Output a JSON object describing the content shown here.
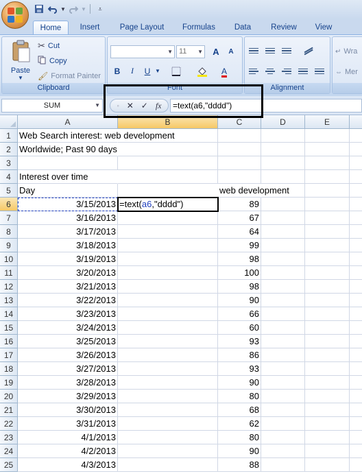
{
  "quick_access": {
    "save_icon": "save-icon",
    "undo_icon": "undo-icon",
    "redo_icon": "redo-icon",
    "customize_icon": "customize-icon"
  },
  "tabs": [
    "Home",
    "Insert",
    "Page Layout",
    "Formulas",
    "Data",
    "Review",
    "View"
  ],
  "ribbon": {
    "clipboard": {
      "paste": "Paste",
      "cut": "Cut",
      "copy": "Copy",
      "format_painter": "Format Painter",
      "label": "Clipboard"
    },
    "font": {
      "font_name": "",
      "font_size": "11",
      "label": "Font",
      "bold": "B",
      "italic": "I",
      "underline": "U",
      "grow": "A",
      "shrink": "A",
      "font_color": "A"
    },
    "alignment": {
      "label": "Alignment",
      "wrap": "Wra",
      "merge": "Mer"
    }
  },
  "formula_bar": {
    "name_box": "SUM",
    "formula": "=text(a6,\"dddd\")",
    "cancel": "✕",
    "enter": "✓",
    "fx": "fx"
  },
  "columns": [
    "A",
    "B",
    "C",
    "D",
    "E"
  ],
  "rows": [
    {
      "num": "1",
      "a": "Web Search interest: web development",
      "b": "",
      "c": ""
    },
    {
      "num": "2",
      "a": "Worldwide; Past 90 days",
      "b": "",
      "c": ""
    },
    {
      "num": "3",
      "a": "",
      "b": "",
      "c": ""
    },
    {
      "num": "4",
      "a": "Interest over time",
      "b": "",
      "c": ""
    },
    {
      "num": "5",
      "a": "Day",
      "b": "",
      "c": "web development"
    },
    {
      "num": "6",
      "a": "3/15/2013",
      "b": "",
      "c": "89"
    },
    {
      "num": "7",
      "a": "3/16/2013",
      "b": "",
      "c": "67"
    },
    {
      "num": "8",
      "a": "3/17/2013",
      "b": "",
      "c": "64"
    },
    {
      "num": "9",
      "a": "3/18/2013",
      "b": "",
      "c": "99"
    },
    {
      "num": "10",
      "a": "3/19/2013",
      "b": "",
      "c": "98"
    },
    {
      "num": "11",
      "a": "3/20/2013",
      "b": "",
      "c": "100"
    },
    {
      "num": "12",
      "a": "3/21/2013",
      "b": "",
      "c": "98"
    },
    {
      "num": "13",
      "a": "3/22/2013",
      "b": "",
      "c": "90"
    },
    {
      "num": "14",
      "a": "3/23/2013",
      "b": "",
      "c": "66"
    },
    {
      "num": "15",
      "a": "3/24/2013",
      "b": "",
      "c": "60"
    },
    {
      "num": "16",
      "a": "3/25/2013",
      "b": "",
      "c": "93"
    },
    {
      "num": "17",
      "a": "3/26/2013",
      "b": "",
      "c": "86"
    },
    {
      "num": "18",
      "a": "3/27/2013",
      "b": "",
      "c": "93"
    },
    {
      "num": "19",
      "a": "3/28/2013",
      "b": "",
      "c": "90"
    },
    {
      "num": "20",
      "a": "3/29/2013",
      "b": "",
      "c": "80"
    },
    {
      "num": "21",
      "a": "3/30/2013",
      "b": "",
      "c": "68"
    },
    {
      "num": "22",
      "a": "3/31/2013",
      "b": "",
      "c": "62"
    },
    {
      "num": "23",
      "a": "4/1/2013",
      "b": "",
      "c": "80"
    },
    {
      "num": "24",
      "a": "4/2/2013",
      "b": "",
      "c": "90"
    },
    {
      "num": "25",
      "a": "4/3/2013",
      "b": "",
      "c": "88"
    }
  ],
  "editing_cell": {
    "prefix": "=text(",
    "ref": "a6",
    "suffix": ",\"dddd\")"
  },
  "colors": {
    "ribbon_blue": "#dbe6f5",
    "tab_text": "#15428b",
    "ref_blue": "#1f3ebd",
    "header_selected": "#f6c866"
  }
}
